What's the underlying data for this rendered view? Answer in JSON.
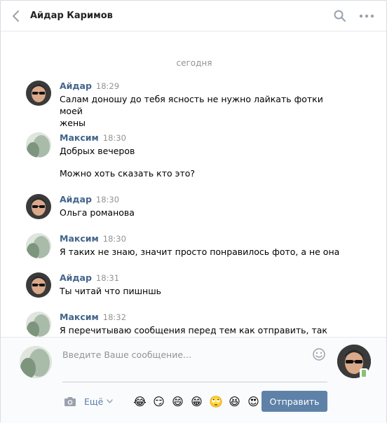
{
  "header": {
    "title": "Айдар Каримов"
  },
  "date_separator": "сегодня",
  "messages": [
    {
      "sender": "Айдар",
      "time": "18:29",
      "lines": [
        "Салам доношу до тебя ясность не нужно лайкать фотки моей",
        "жены"
      ],
      "avatar": "aidar"
    },
    {
      "sender": "Максим",
      "time": "18:30",
      "lines": [
        "Добрых вечеров",
        "",
        "Можно хоть сказать кто это?"
      ],
      "avatar": "maxim"
    },
    {
      "sender": "Айдар",
      "time": "18:30",
      "lines": [
        "Ольга романова"
      ],
      "avatar": "aidar"
    },
    {
      "sender": "Максим",
      "time": "18:30",
      "lines": [
        "Я таких не знаю, значит просто понравилось фото, а не она"
      ],
      "avatar": "maxim"
    },
    {
      "sender": "Айдар",
      "time": "18:31",
      "lines": [
        "Ты читай что пишншь"
      ],
      "avatar": "aidar"
    },
    {
      "sender": "Максим",
      "time": "18:32",
      "lines": [
        "Я перечитываю сообщения перед тем как отправить, так что"
      ],
      "avatar": "maxim"
    }
  ],
  "composer": {
    "placeholder": "Введите Ваше сообщение...",
    "more_label": "Ещё",
    "send_label": "Отправить",
    "emojis": [
      "😂",
      "😏",
      "😄",
      "😁",
      "🙄",
      "😆",
      "😍"
    ]
  }
}
